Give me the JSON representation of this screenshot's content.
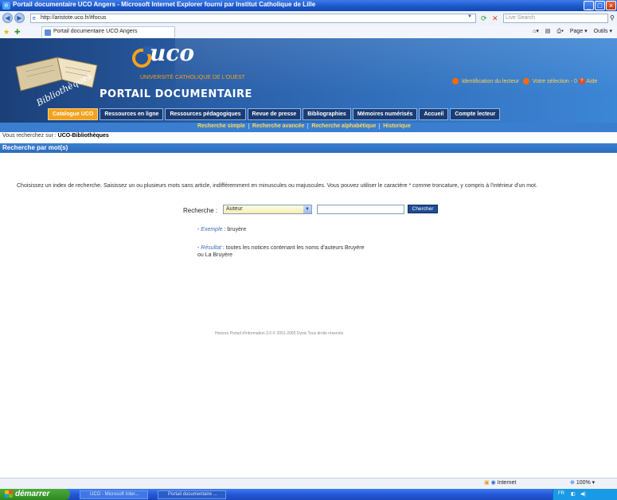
{
  "browser": {
    "title": "Portail documentaire UCO Angers - Microsoft Internet Explorer fourni par Institut Catholique de Lille",
    "url": "http://aristote.uco.fr/#focus",
    "search_placeholder": "Live Search",
    "tab_label": "Portail documentaire UCO Angers",
    "commands": [
      "Page ▾",
      "Outils ▾"
    ]
  },
  "site": {
    "book_tagline": "Bibliothèques",
    "logo_text": "uco",
    "logo_subtitle": "UNIVERSITÉ CATHOLIQUE DE L'OUEST",
    "portal_title": "PORTAIL DOCUMENTAIRE",
    "user_links": {
      "identification": "Identification du lecteur",
      "selection": "Votre sélection - 0",
      "help": "Aide"
    },
    "main_tabs": [
      {
        "label": "Catalogue UCO",
        "active": true
      },
      {
        "label": "Ressources en ligne",
        "active": false
      },
      {
        "label": "Ressources pédagogiques",
        "active": false
      },
      {
        "label": "Revue de presse",
        "active": false
      },
      {
        "label": "Bibliographies",
        "active": false
      },
      {
        "label": "Mémoires numérisés",
        "active": false
      },
      {
        "label": "Accueil",
        "active": false
      },
      {
        "label": "Compte lecteur",
        "active": false
      }
    ],
    "sub_tabs": [
      "Recherche simple",
      "Recherche avancée",
      "Recherche alphabétique",
      "Historique"
    ]
  },
  "breadcrumb": {
    "prefix": "Vous recherchez sur :",
    "location": "UCO-Bibliothèques"
  },
  "section_title": "Recherche par mot(s)",
  "instructions": "Choisissez un index de recherche. Saisissez un ou plusieurs mots sans article, indifféremment en minuscules ou majuscules. Vous pouvez utiliser le caractère * comme troncature, y compris à l'intérieur d'un mot.",
  "search": {
    "label": "Recherche :",
    "index_value": "Auteur",
    "query_value": "",
    "button_label": "Chercher"
  },
  "example": {
    "label": "Exemple",
    "text": ": bruyère"
  },
  "result": {
    "label": "Résultat",
    "text": ": toutes les notices contenant les noms d'auteurs Bruyère ou La Bruyère"
  },
  "footer": "Horizon Portail d'information 3.0 © 2001-2005 Dynix Tous droits réservés",
  "status": {
    "zone": "Internet",
    "zoom": "100%"
  },
  "taskbar": {
    "start_label": "démarrer",
    "tasks": [
      "UCO - Microsoft Inter...",
      "Portail documentaire ..."
    ],
    "tray_lang": "FR"
  }
}
